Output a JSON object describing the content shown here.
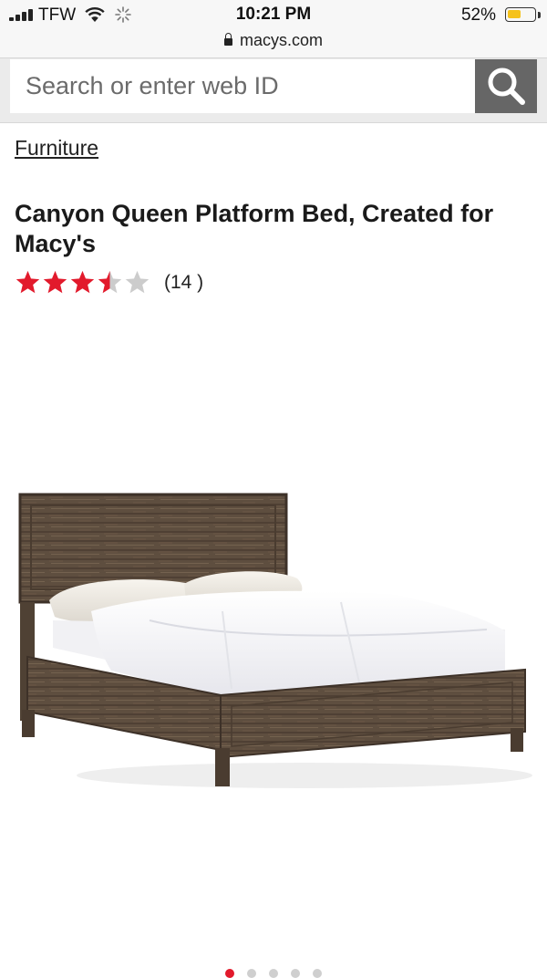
{
  "status_bar": {
    "carrier": "TFW",
    "time": "10:21 PM",
    "battery_percent": "52%",
    "battery_level": 0.52,
    "battery_color": "#f5c21b"
  },
  "browser": {
    "url": "macys.com"
  },
  "search": {
    "placeholder": "Search or enter web ID",
    "button_icon": "search-icon"
  },
  "breadcrumb": "Furniture",
  "product": {
    "title": "Canyon Queen Platform Bed, Created for Macy's",
    "rating": 3.5,
    "rating_max": 5,
    "review_count": "(14 )",
    "star_color": "#e21a2c",
    "star_empty_color": "#cccccc"
  },
  "carousel": {
    "count": 5,
    "active_index": 0,
    "active_color": "#e21a2c"
  }
}
